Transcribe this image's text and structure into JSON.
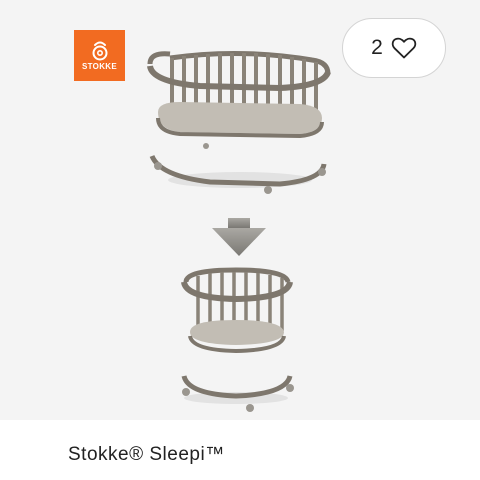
{
  "brand": {
    "logo_text": "STOKKE",
    "color": "#f26b21"
  },
  "likes": {
    "count": "2",
    "icon": "heart-outline-icon"
  },
  "product": {
    "title": "Stokke® Sleepi™"
  },
  "colors": {
    "crib": "#7e776d",
    "image_background": "#f4f4f4",
    "arrow": "#8d8b86"
  }
}
